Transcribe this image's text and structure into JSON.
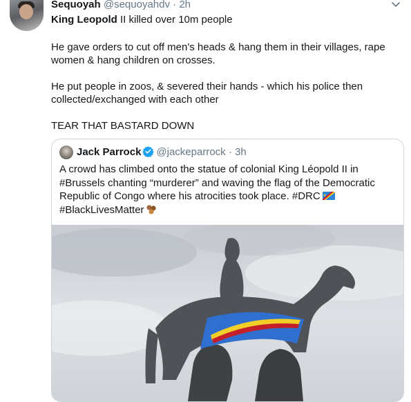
{
  "tweet": {
    "author_name": "Sequoyah",
    "author_handle": "@sequoyahdv",
    "separator": "·",
    "time": "2h",
    "line1_bold": "King Leopold",
    "line1_rest": " II killed over 10m people",
    "paragraph2_line1": "He gave orders to cut off men's heads & hang them in their villages, rape",
    "paragraph2_line2": "women & hang children on crosses.",
    "paragraph3_line1": "He put people in zoos, & severed their hands - which his police then",
    "paragraph3_line2": "collected/exchanged with each other",
    "paragraph4": "TEAR THAT BASTARD DOWN"
  },
  "quoted_tweet": {
    "author_name": "Jack Parrock",
    "author_handle": "@jackeparrock",
    "separator": "·",
    "time": "3h",
    "text_line1": "A crowd has climbed onto the statue of colonial King Léopold II in",
    "text_line2": "#Brussels chanting “murderer” and waving the flag of the Democratic",
    "text_line3": "Republic of Congo where his atrocities took place. #DRC",
    "text_line4": "#BlackLivesMatter"
  },
  "icons": {
    "menu": "chevron-down-icon",
    "verified": "verified-badge-icon",
    "flag": "drc-flag-emoji",
    "fist": "raised-fist-emoji"
  },
  "colors": {
    "text": "#14171a",
    "secondary": "#657786",
    "verified_blue": "#1da1f2",
    "border": "#ccd6dd"
  }
}
